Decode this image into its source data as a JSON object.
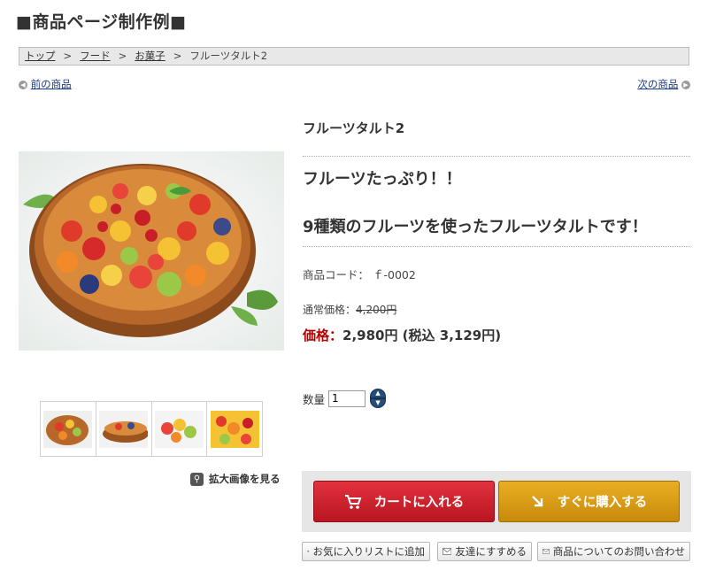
{
  "page": {
    "title": "■商品ページ制作例■"
  },
  "breadcrumb": {
    "items": [
      "トップ",
      "フード",
      "お菓子"
    ],
    "current": "フルーツタルト2",
    "separator": ">"
  },
  "nav": {
    "prev": "前の商品",
    "next": "次の商品"
  },
  "product": {
    "name": "フルーツタルト2",
    "catch1": "フルーツたっぷり！！",
    "catch2": "9種類のフルーツを使ったフルーツタルトです！",
    "code_label": "商品コード：",
    "code_value": "ｆ-0002",
    "regular_label": "通常価格：",
    "regular_value": "4,200円",
    "price_label": "価格：",
    "price_value": "2,980円 (税込 3,129円)",
    "qty_label": "数量",
    "qty_value": "1"
  },
  "gallery": {
    "zoom_label": "拡大画像を見る",
    "thumb_count": 4
  },
  "actions": {
    "cart": "カートに入れる",
    "buy_now": "すぐに購入する",
    "favorite": "お気に入りリストに追加",
    "recommend": "友達にすすめる",
    "inquiry": "商品についてのお問い合わせ"
  },
  "colors": {
    "price_label": "#b10000",
    "cart_button": "#c81e28",
    "buy_button": "#d99a14",
    "link": "#1a3b8a"
  }
}
